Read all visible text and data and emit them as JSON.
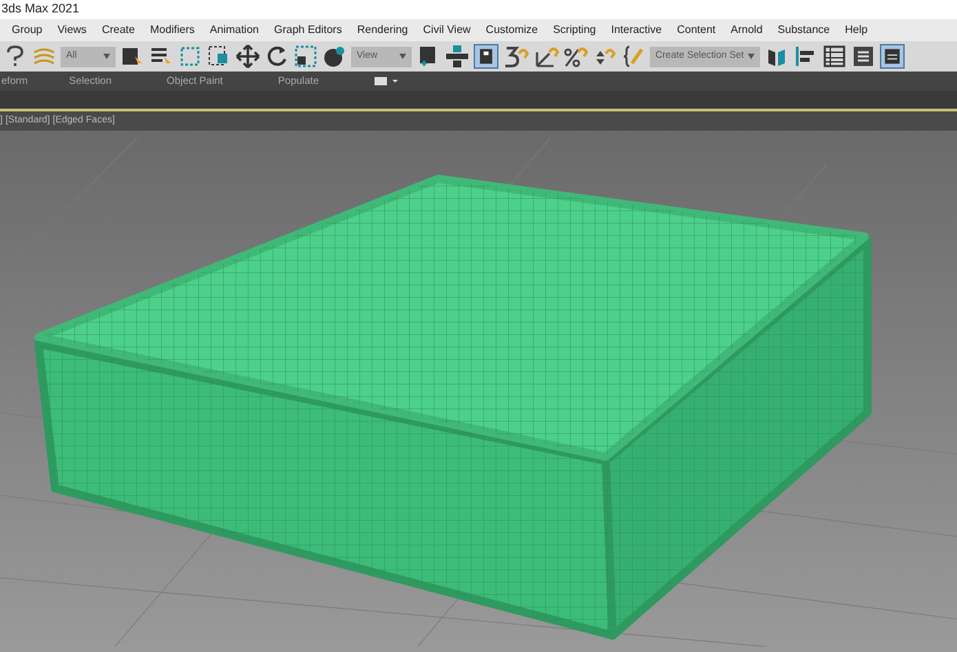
{
  "window": {
    "title": "3ds Max 2021"
  },
  "menu": [
    "Group",
    "Views",
    "Create",
    "Modifiers",
    "Animation",
    "Graph Editors",
    "Rendering",
    "Civil View",
    "Customize",
    "Scripting",
    "Interactive",
    "Content",
    "Arnold",
    "Substance",
    "Help"
  ],
  "toolbar": {
    "selection_filter": "All",
    "reference_coord": "View",
    "selection_set": "Create Selection Set"
  },
  "ribbon_tabs": [
    {
      "label": "eform",
      "selected": false
    },
    {
      "label": "Selection",
      "selected": false
    },
    {
      "label": "Object Paint",
      "selected": false
    },
    {
      "label": "Populate",
      "selected": false
    }
  ],
  "viewport": {
    "labels": [
      "]",
      "[Standard]",
      "[Edged Faces]"
    ]
  }
}
